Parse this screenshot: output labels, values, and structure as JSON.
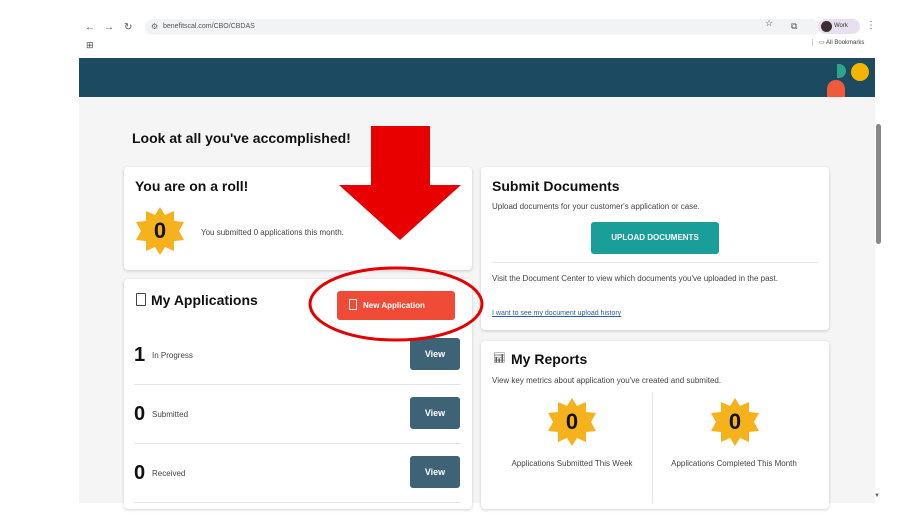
{
  "browser": {
    "url": "benefitscal.com/CBO/CBDAS",
    "profile_name": "Work",
    "bookmarks_label": "All Bookmarks",
    "back_glyph": "←",
    "forward_glyph": "→",
    "reload_glyph": "↻",
    "star_glyph": "☆",
    "menu_glyph": "⋮"
  },
  "page": {
    "heading": "Look at all you've accomplished!",
    "roll_card": {
      "title": "You are on a roll!",
      "badge_value": "0",
      "message": "You submitted 0 applications this month."
    },
    "applications": {
      "title": "My Applications",
      "new_button": "New Application",
      "rows": [
        {
          "count": "1",
          "label": "In Progress",
          "button": "View"
        },
        {
          "count": "0",
          "label": "Submitted",
          "button": "View"
        },
        {
          "count": "0",
          "label": "Received",
          "button": "View"
        }
      ]
    },
    "documents": {
      "title": "Submit Documents",
      "description": "Upload documents for your customer's application or case.",
      "upload_button": "UPLOAD DOCUMENTS",
      "center_text": "Visit the Document Center to view which documents you've uploaded in the past.",
      "history_link": "I want to see my document upload history"
    },
    "reports": {
      "title": "My Reports",
      "description": "View key metrics about application you've created and submited.",
      "metrics": [
        {
          "value": "0",
          "label": "Applications Submitted This Week"
        },
        {
          "value": "0",
          "label": "Applications Completed This Month"
        }
      ]
    }
  },
  "colors": {
    "banner": "#1c4a60",
    "badge": "#f5b21d",
    "new_application": "#ef4b36",
    "upload": "#1a9e9a",
    "view": "#3e6276",
    "annotation": "#e50000"
  },
  "icons": [
    "document-icon",
    "chart-icon",
    "star-badge-icon",
    "down-arrow-annotation",
    "circle-annotation"
  ]
}
